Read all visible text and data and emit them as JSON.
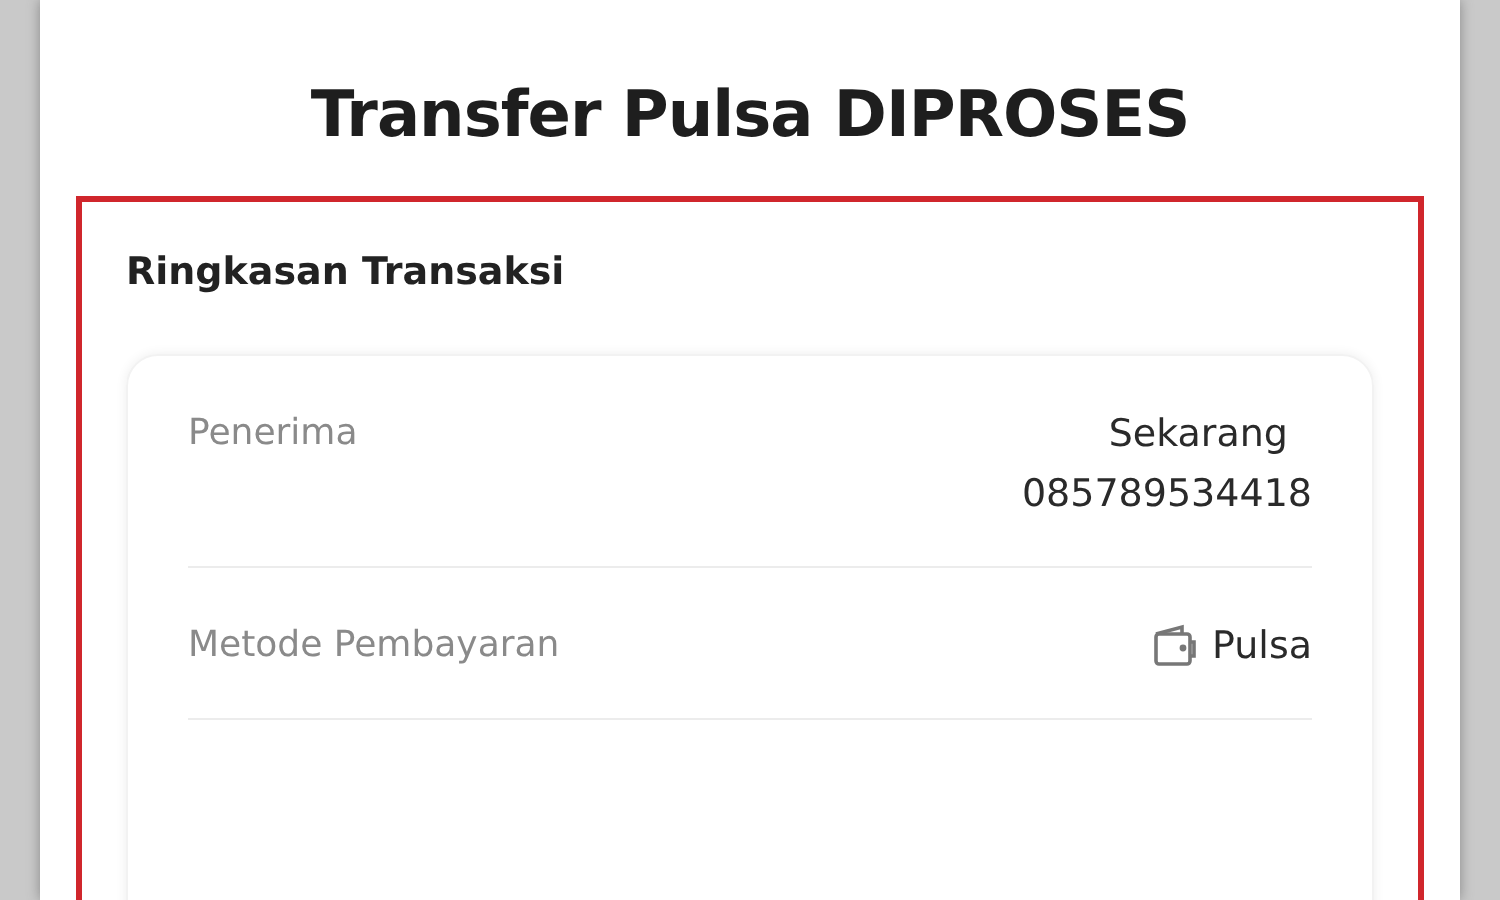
{
  "title": "Transfer Pulsa DIPROSES",
  "summary": {
    "heading": "Ringkasan Transaksi",
    "rows": [
      {
        "kind": "lines",
        "label": "Penerima",
        "values": [
          "Sekarang",
          "085789534418"
        ]
      },
      {
        "kind": "wallet",
        "label": "Metode Pembayaran",
        "values": [
          "Pulsa"
        ]
      }
    ]
  }
}
